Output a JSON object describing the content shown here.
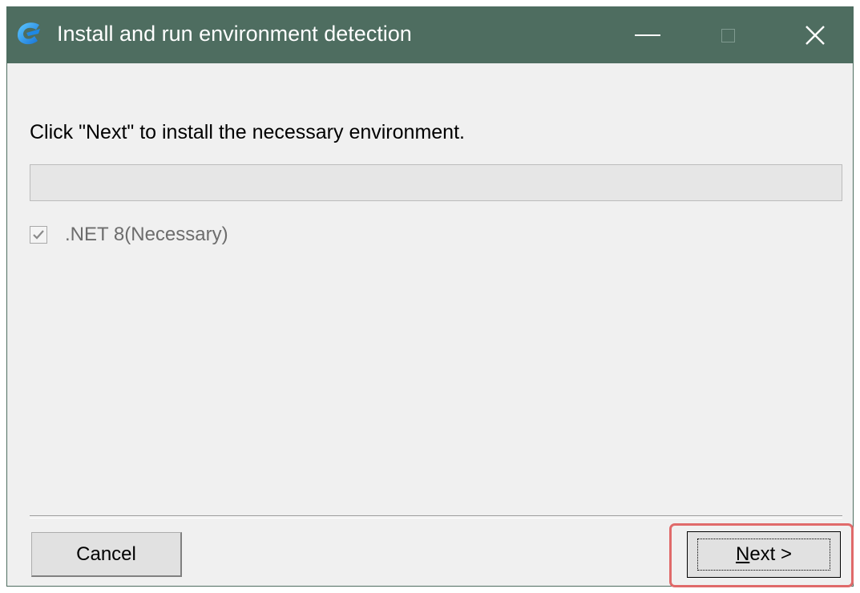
{
  "window": {
    "title": "Install and run environment detection",
    "controls": {
      "minimize_icon": "minimize-icon",
      "maximize_icon": "maximize-icon",
      "close_glyph": "✕"
    },
    "titlebar_color": "#4e6d60"
  },
  "content": {
    "instruction": "Click \"Next\" to install the necessary environment.",
    "progress": {
      "value": 0
    },
    "components": [
      {
        "label": ".NET 8(Necessary)",
        "checked": true,
        "enabled": false
      }
    ]
  },
  "buttons": {
    "cancel_label": "Cancel",
    "next_mnemonic": "N",
    "next_rest": "ext >"
  },
  "highlight_color": "#e06a6a"
}
